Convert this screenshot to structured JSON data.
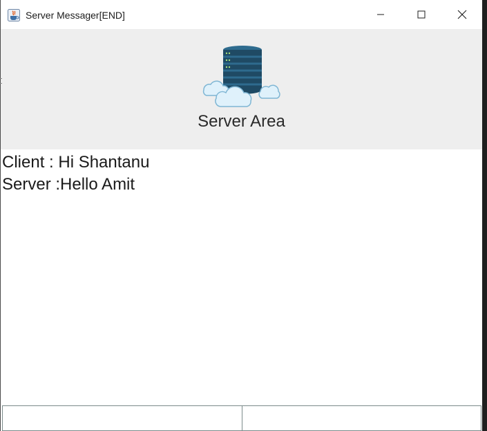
{
  "window": {
    "title": "Server Messager[END]"
  },
  "header": {
    "title": "Server Area",
    "icon": "server-cloud-icon"
  },
  "messages": [
    {
      "text": "Client : Hi Shantanu"
    },
    {
      "text": "Server :Hello Amit"
    }
  ],
  "input": {
    "left_value": "",
    "right_value": ""
  },
  "colors": {
    "header_bg": "#eeeeee",
    "server_dark": "#1f4a64",
    "server_light": "#2e6b8e",
    "cloud": "#dff1fb",
    "cloud_stroke": "#7fb6d4"
  }
}
